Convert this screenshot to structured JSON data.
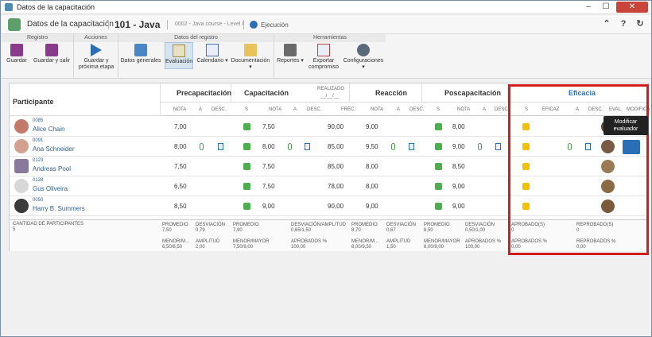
{
  "window": {
    "title": "Datos de la capacitación"
  },
  "header": {
    "app_title": "Datos de la capacitación",
    "record": "101 - Java",
    "course": "0002 - Java course - Level I",
    "status": "Ejecución"
  },
  "ribbon": {
    "groups": {
      "registro": "Registro",
      "acciones": "Acciones",
      "datos": "Datos del registro",
      "herramientas": "Herramientas"
    },
    "buttons": {
      "guardar": "Guardar",
      "guardar_salir": "Guardar y salir",
      "guardar_proxima_1": "Guardar y",
      "guardar_proxima_2": "próxima etapa",
      "datos_generales": "Datos generales",
      "evaluacion": "Evaluación",
      "calendario": "Calendario",
      "documentacion": "Documentación",
      "reportes": "Reportes",
      "exportar_1": "Exportar",
      "exportar_2": "compromiso",
      "configuraciones": "Configuraciones"
    }
  },
  "table": {
    "participante": "Participante",
    "precapacitacion": "Precapacitación",
    "capacitacion": "Capacitación",
    "realizado": "REALIZADO",
    "realizado_date": "__/__/__",
    "reaccion": "Reacción",
    "poscapacitacion": "Poscapacitación",
    "eficacia": "Eficacia",
    "sub": {
      "nota": "NOTA",
      "a": "A",
      "desc": "DESC.",
      "s": "S",
      "frec": "FREC.",
      "eficaz": "EFICAZ",
      "eval": "EVAL.",
      "modifica": "MODIFICA"
    },
    "rows": [
      {
        "id": "0085",
        "name": "Alice Chain",
        "pre": "7,00",
        "cap": "7,50",
        "frec": "90,00",
        "rea": "9,00",
        "pos": "8,00"
      },
      {
        "id": "0091",
        "name": "Ana Schneider",
        "pre": "8,00",
        "cap": "8,00",
        "frec": "85,00",
        "rea": "9,50",
        "pos": "9,00"
      },
      {
        "id": "0123",
        "name": "Andreas Pool",
        "pre": "7,50",
        "cap": "7,50",
        "frec": "85,00",
        "rea": "8,00",
        "pos": "8,50"
      },
      {
        "id": "0128",
        "name": "Gus Oliveira",
        "pre": "6,50",
        "cap": "7,50",
        "frec": "78,00",
        "rea": "8,00",
        "pos": "9,00"
      },
      {
        "id": "0050",
        "name": "Harry B. Summers",
        "pre": "8,50",
        "cap": "9,00",
        "frec": "90,00",
        "rea": "9,00",
        "pos": "9,00"
      }
    ],
    "footer": {
      "cantidad": "CANTIDAD DE PARTICIPANTES",
      "cantidad_val": "5",
      "pre": {
        "promedio": "PROMEDIO",
        "promedio_val": "7,50",
        "desv": "DESVIACIÓN",
        "desv_val": "0,79",
        "menor": "MENOR/M...",
        "menor_val": "6,50/8,50",
        "amp": "AMPLITUD",
        "amp_val": "2,00"
      },
      "cap": {
        "promedio": "PROMEDIO",
        "promedio_val": "7,90",
        "desv": "DESVIACIÓN/AMPLITUD",
        "desv_val": "0,65/1,50",
        "menor": "MENOR/MAYOR",
        "menor_val": "7,50/9,00",
        "apro": "APROBADOS %",
        "apro_val": "100,00"
      },
      "rea": {
        "promedio": "PROMEDIO",
        "promedio_val": "8,70",
        "desv": "DESVIACIÓN",
        "desv_val": "0,67",
        "menor": "MENOR/M...",
        "menor_val": "8,00/9,50",
        "amp": "AMPLITUD",
        "amp_val": "1,50"
      },
      "pos": {
        "promedio": "PROMEDIO",
        "promedio_val": "8,50",
        "desv": "DESVIACIÓN",
        "desv_val": "0,50/1,00",
        "menor": "MENOR/MAYOR",
        "menor_val": "8,00/9,00",
        "apro": "APROBADOS %",
        "apro_val": "100,00"
      },
      "efi": {
        "apro": "APROBADO(S)",
        "apro_val": "0",
        "repro": "REPROBADO(S)",
        "repro_val": "0",
        "apro_pct": "APROBADOS %",
        "apro_pct_val": "0,00",
        "repro_pct": "REPROBADOS %",
        "repro_pct_val": "0,00"
      }
    }
  },
  "tooltip": {
    "line1": "Modificar",
    "line2": "evaluador"
  },
  "colors": {
    "accent": "#2a6fb5",
    "highlight": "#d21d1d",
    "check": "#4cae4c",
    "warning": "#f2c200"
  }
}
